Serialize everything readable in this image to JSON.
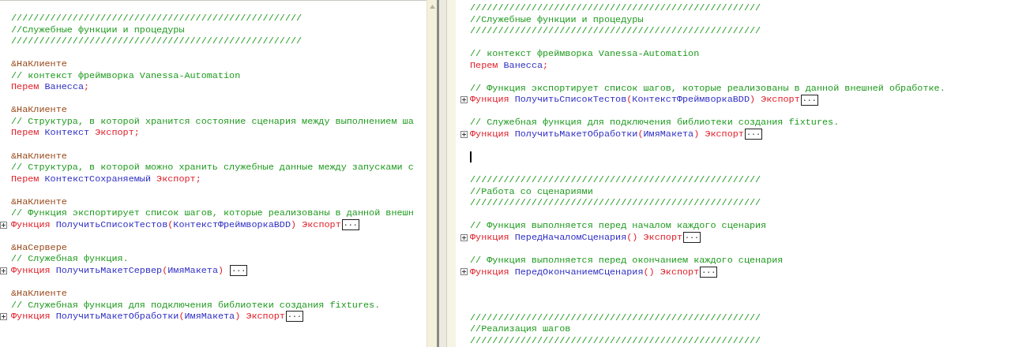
{
  "panes": [
    {
      "lines": [
        {
          "kind": "code",
          "tokens": [
            {
              "kind": "comment",
              "text": "////////////////////////////////////////////////////"
            }
          ]
        },
        {
          "kind": "code",
          "tokens": [
            {
              "kind": "comment",
              "text": "//Служебные функции и процедуры"
            }
          ]
        },
        {
          "kind": "code",
          "tokens": [
            {
              "kind": "comment",
              "text": "////////////////////////////////////////////////////"
            }
          ]
        },
        {
          "kind": "blank"
        },
        {
          "kind": "code",
          "tokens": [
            {
              "kind": "directive",
              "text": "&НаКлиенте"
            }
          ]
        },
        {
          "kind": "code",
          "tokens": [
            {
              "kind": "comment",
              "text": "// контекст фреймворка Vanessa-Automation"
            }
          ]
        },
        {
          "kind": "code",
          "tokens": [
            {
              "kind": "keyword",
              "text": "Перем "
            },
            {
              "kind": "ident",
              "text": "Ванесса"
            },
            {
              "kind": "punct",
              "text": ";"
            }
          ]
        },
        {
          "kind": "blank"
        },
        {
          "kind": "code",
          "tokens": [
            {
              "kind": "directive",
              "text": "&НаКлиенте"
            }
          ]
        },
        {
          "kind": "code",
          "tokens": [
            {
              "kind": "comment",
              "text": "// Структура, в которой хранится состояние сценария между выполнением ша"
            }
          ]
        },
        {
          "kind": "code",
          "tokens": [
            {
              "kind": "keyword",
              "text": "Перем "
            },
            {
              "kind": "ident",
              "text": "Контекст "
            },
            {
              "kind": "keyword",
              "text": "Экспорт"
            },
            {
              "kind": "punct",
              "text": ";"
            }
          ]
        },
        {
          "kind": "blank"
        },
        {
          "kind": "code",
          "tokens": [
            {
              "kind": "directive",
              "text": "&НаКлиенте"
            }
          ]
        },
        {
          "kind": "code",
          "tokens": [
            {
              "kind": "comment",
              "text": "// Структура, в которой можно хранить служебные данные между запусками с"
            }
          ]
        },
        {
          "kind": "code",
          "tokens": [
            {
              "kind": "keyword",
              "text": "Перем "
            },
            {
              "kind": "ident",
              "text": "КонтекстСохраняемый "
            },
            {
              "kind": "keyword",
              "text": "Экспорт"
            },
            {
              "kind": "punct",
              "text": ";"
            }
          ]
        },
        {
          "kind": "blank"
        },
        {
          "kind": "code",
          "tokens": [
            {
              "kind": "directive",
              "text": "&НаКлиенте"
            }
          ]
        },
        {
          "kind": "code",
          "tokens": [
            {
              "kind": "comment",
              "text": "// Функция экспортирует список шагов, которые реализованы в данной внешн"
            }
          ]
        },
        {
          "kind": "folded",
          "marker": "...",
          "tokens": [
            {
              "kind": "keyword",
              "text": "Функция "
            },
            {
              "kind": "ident",
              "text": "ПолучитьСписокТестов"
            },
            {
              "kind": "punct",
              "text": "("
            },
            {
              "kind": "ident",
              "text": "КонтекстФреймворкаBDD"
            },
            {
              "kind": "punct",
              "text": ") "
            },
            {
              "kind": "keyword",
              "text": "Экспорт"
            }
          ]
        },
        {
          "kind": "blank"
        },
        {
          "kind": "code",
          "tokens": [
            {
              "kind": "directive",
              "text": "&НаСервере"
            }
          ]
        },
        {
          "kind": "code",
          "tokens": [
            {
              "kind": "comment",
              "text": "// Служебная функция."
            }
          ]
        },
        {
          "kind": "folded",
          "marker": "...",
          "tokens": [
            {
              "kind": "keyword",
              "text": "Функция "
            },
            {
              "kind": "ident",
              "text": "ПолучитьМакетСервер"
            },
            {
              "kind": "punct",
              "text": "("
            },
            {
              "kind": "ident",
              "text": "ИмяМакета"
            },
            {
              "kind": "punct",
              "text": ") "
            }
          ]
        },
        {
          "kind": "blank"
        },
        {
          "kind": "code",
          "tokens": [
            {
              "kind": "directive",
              "text": "&НаКлиенте"
            }
          ]
        },
        {
          "kind": "code",
          "tokens": [
            {
              "kind": "comment",
              "text": "// Служебная функция для подключения библиотеки создания fixtures."
            }
          ]
        },
        {
          "kind": "folded",
          "marker": "...",
          "tokens": [
            {
              "kind": "keyword",
              "text": "Функция "
            },
            {
              "kind": "ident",
              "text": "ПолучитьМакетОбработки"
            },
            {
              "kind": "punct",
              "text": "("
            },
            {
              "kind": "ident",
              "text": "ИмяМакета"
            },
            {
              "kind": "punct",
              "text": ") "
            },
            {
              "kind": "keyword",
              "text": "Экспорт"
            }
          ]
        }
      ]
    },
    {
      "lines": [
        {
          "kind": "code",
          "tokens": [
            {
              "kind": "comment",
              "text": "////////////////////////////////////////////////////"
            }
          ]
        },
        {
          "kind": "code",
          "tokens": [
            {
              "kind": "comment",
              "text": "//Служебные функции и процедуры"
            }
          ]
        },
        {
          "kind": "code",
          "tokens": [
            {
              "kind": "comment",
              "text": "////////////////////////////////////////////////////"
            }
          ]
        },
        {
          "kind": "blank"
        },
        {
          "kind": "code",
          "tokens": [
            {
              "kind": "comment",
              "text": "// контекст фреймворка Vanessa-Automation"
            }
          ]
        },
        {
          "kind": "code",
          "tokens": [
            {
              "kind": "keyword",
              "text": "Перем "
            },
            {
              "kind": "ident",
              "text": "Ванесса"
            },
            {
              "kind": "punct",
              "text": ";"
            }
          ]
        },
        {
          "kind": "blank"
        },
        {
          "kind": "code",
          "tokens": [
            {
              "kind": "comment",
              "text": "// Функция экспортирует список шагов, которые реализованы в данной внешней обработке."
            }
          ]
        },
        {
          "kind": "folded",
          "marker": "...",
          "tokens": [
            {
              "kind": "keyword",
              "text": "Функция "
            },
            {
              "kind": "ident",
              "text": "ПолучитьСписокТестов"
            },
            {
              "kind": "punct",
              "text": "("
            },
            {
              "kind": "ident",
              "text": "КонтекстФреймворкаBDD"
            },
            {
              "kind": "punct",
              "text": ") "
            },
            {
              "kind": "keyword",
              "text": "Экспорт"
            }
          ]
        },
        {
          "kind": "blank"
        },
        {
          "kind": "code",
          "tokens": [
            {
              "kind": "comment",
              "text": "// Служебная функция для подключения библиотеки создания fixtures."
            }
          ]
        },
        {
          "kind": "folded",
          "marker": "...",
          "tokens": [
            {
              "kind": "keyword",
              "text": "Функция "
            },
            {
              "kind": "ident",
              "text": "ПолучитьМакетОбработки"
            },
            {
              "kind": "punct",
              "text": "("
            },
            {
              "kind": "ident",
              "text": "ИмяМакета"
            },
            {
              "kind": "punct",
              "text": ") "
            },
            {
              "kind": "keyword",
              "text": "Экспорт"
            }
          ]
        },
        {
          "kind": "blank"
        },
        {
          "kind": "cursor"
        },
        {
          "kind": "blank"
        },
        {
          "kind": "code",
          "tokens": [
            {
              "kind": "comment",
              "text": "////////////////////////////////////////////////////"
            }
          ]
        },
        {
          "kind": "code",
          "tokens": [
            {
              "kind": "comment",
              "text": "//Работа со сценариями"
            }
          ]
        },
        {
          "kind": "code",
          "tokens": [
            {
              "kind": "comment",
              "text": "////////////////////////////////////////////////////"
            }
          ]
        },
        {
          "kind": "blank"
        },
        {
          "kind": "code",
          "tokens": [
            {
              "kind": "comment",
              "text": "// Функция выполняется перед началом каждого сценария"
            }
          ]
        },
        {
          "kind": "folded",
          "marker": "...",
          "tokens": [
            {
              "kind": "keyword",
              "text": "Функция "
            },
            {
              "kind": "ident",
              "text": "ПередНачаломСценария"
            },
            {
              "kind": "punct",
              "text": "() "
            },
            {
              "kind": "keyword",
              "text": "Экспорт"
            }
          ]
        },
        {
          "kind": "blank"
        },
        {
          "kind": "code",
          "tokens": [
            {
              "kind": "comment",
              "text": "// Функция выполняется перед окончанием каждого сценария"
            }
          ]
        },
        {
          "kind": "folded",
          "marker": "...",
          "tokens": [
            {
              "kind": "keyword",
              "text": "Функция "
            },
            {
              "kind": "ident",
              "text": "ПередОкончаниемСценария"
            },
            {
              "kind": "punct",
              "text": "() "
            },
            {
              "kind": "keyword",
              "text": "Экспорт"
            }
          ]
        },
        {
          "kind": "blank"
        },
        {
          "kind": "blank"
        },
        {
          "kind": "blank"
        },
        {
          "kind": "code",
          "tokens": [
            {
              "kind": "comment",
              "text": "////////////////////////////////////////////////////"
            }
          ]
        },
        {
          "kind": "code",
          "tokens": [
            {
              "kind": "comment",
              "text": "//Реализация шагов"
            }
          ]
        },
        {
          "kind": "code",
          "tokens": [
            {
              "kind": "comment",
              "text": "////////////////////////////////////////////////////"
            }
          ]
        }
      ]
    }
  ]
}
